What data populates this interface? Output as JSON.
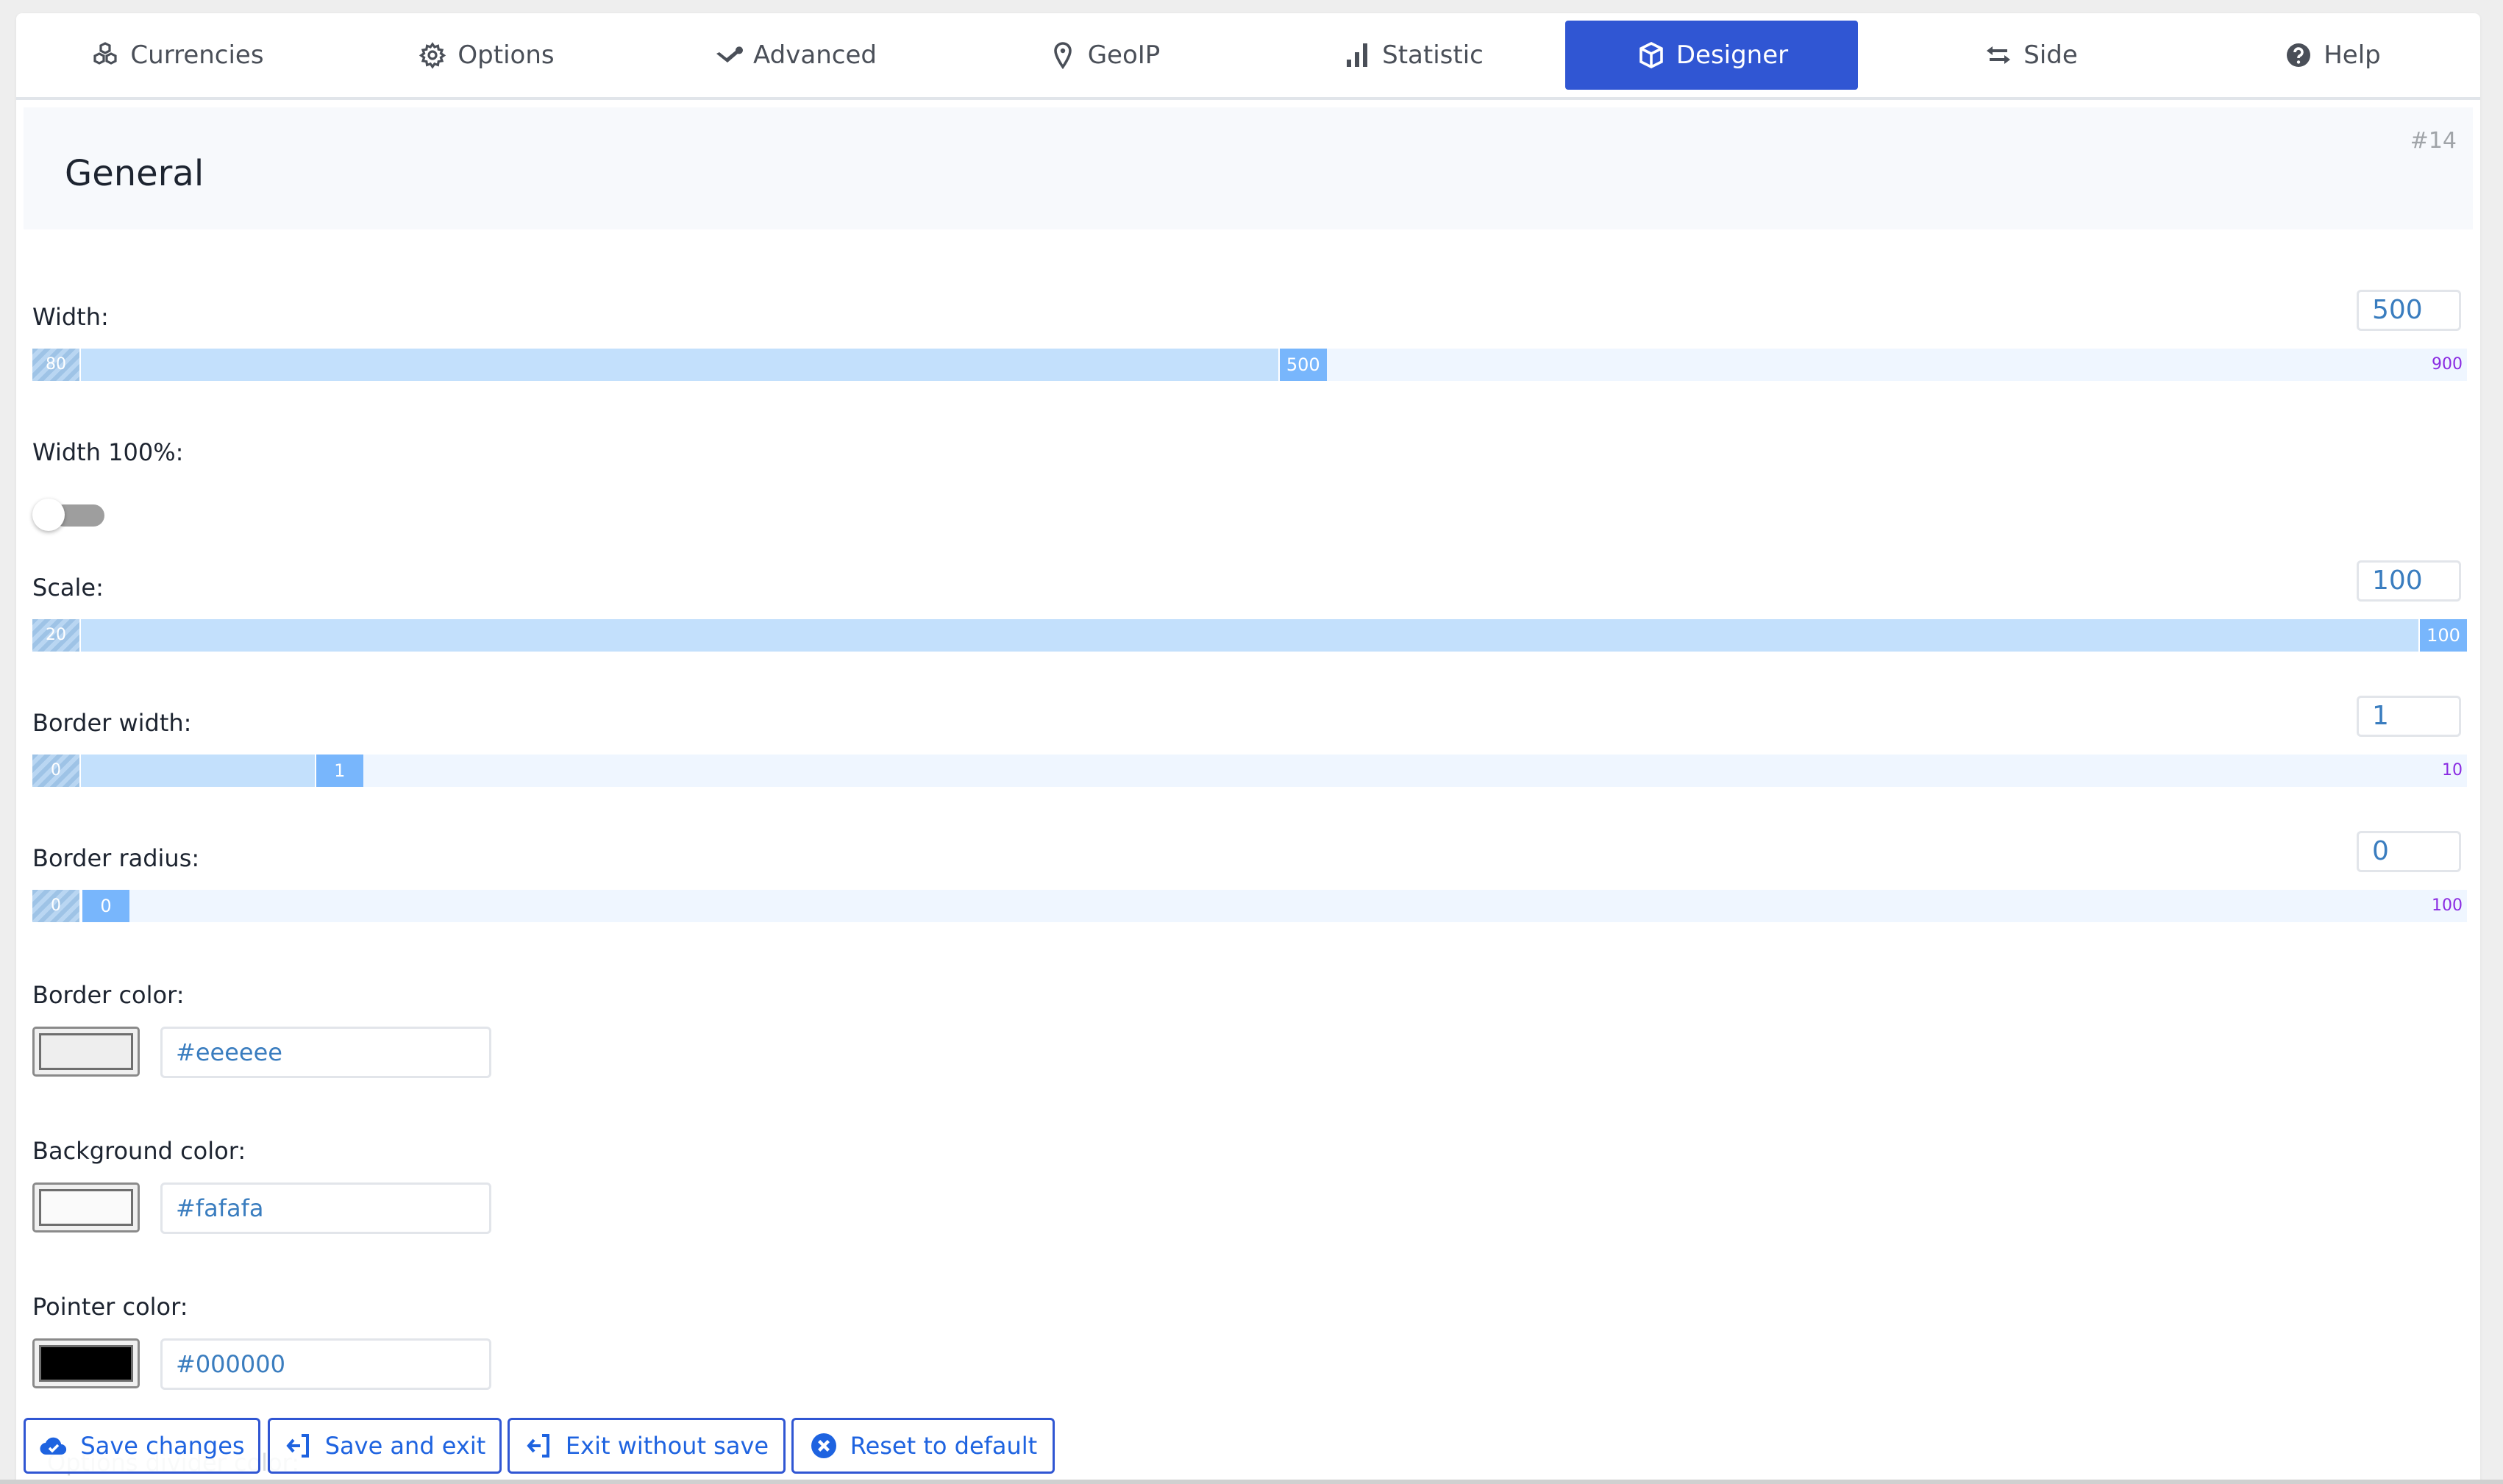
{
  "tabs": [
    {
      "label": "Currencies",
      "icon": "cubes-icon",
      "active": false
    },
    {
      "label": "Options",
      "icon": "gear-icon",
      "active": false
    },
    {
      "label": "Advanced",
      "icon": "wrench-icon",
      "active": false
    },
    {
      "label": "GeoIP",
      "icon": "map-pin-icon",
      "active": false
    },
    {
      "label": "Statistic",
      "icon": "bar-chart-icon",
      "active": false
    },
    {
      "label": "Designer",
      "icon": "cube-icon",
      "active": true
    },
    {
      "label": "Side",
      "icon": "exchange-arrows-icon",
      "active": false
    },
    {
      "label": "Help",
      "icon": "question-circle-icon",
      "active": false
    }
  ],
  "section": {
    "title": "General",
    "id_label": "#14"
  },
  "fields": {
    "width": {
      "label": "Width:",
      "value": "500",
      "min": "80",
      "max": "900",
      "current": "500",
      "min_num": 80,
      "max_num": 900,
      "value_num": 500
    },
    "width100": {
      "label": "Width 100%:",
      "enabled": false
    },
    "scale": {
      "label": "Scale:",
      "value": "100",
      "min": "20",
      "max": "100",
      "current": "100",
      "min_num": 20,
      "max_num": 100,
      "value_num": 100
    },
    "border_width": {
      "label": "Border width:",
      "value": "1",
      "min": "0",
      "max": "10",
      "current": "1",
      "min_num": 0,
      "max_num": 10,
      "value_num": 1
    },
    "border_radius": {
      "label": "Border radius:",
      "value": "0",
      "min": "0",
      "max": "100",
      "current": "0",
      "min_num": 0,
      "max_num": 100,
      "value_num": 0
    },
    "border_color": {
      "label": "Border color:",
      "value": "#eeeeee"
    },
    "background_color": {
      "label": "Background color:",
      "value": "#fafafa"
    },
    "pointer_color": {
      "label": "Pointer color:",
      "value": "#000000"
    },
    "options_divider_color": {
      "label": "Options divider color:"
    }
  },
  "buttons": {
    "save": "Save changes",
    "save_exit": "Save and exit",
    "exit": "Exit without save",
    "reset": "Reset to default"
  },
  "colors": {
    "accent": "#3056d3",
    "link": "#1e63e0",
    "slider_fill": "#c3e0fc",
    "slider_handle": "#78b6fc",
    "slider_max": "#8a2be2"
  }
}
